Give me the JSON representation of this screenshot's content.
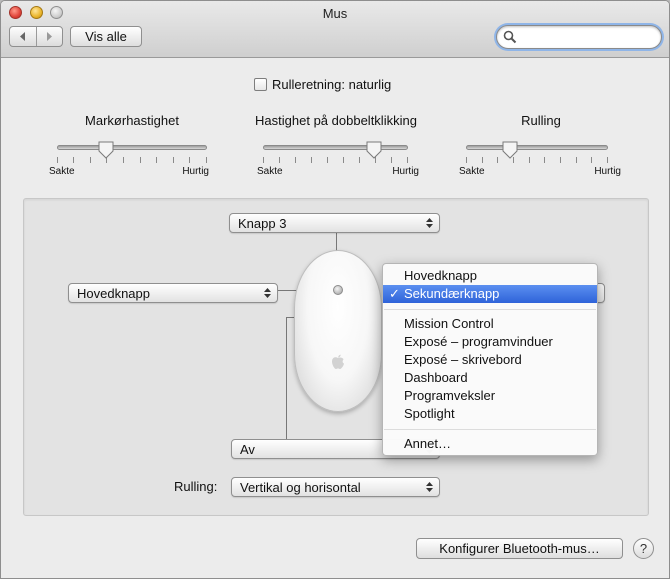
{
  "window": {
    "title": "Mus"
  },
  "toolbar": {
    "show_all_label": "Vis alle",
    "back_icon": "chevron-left-icon",
    "forward_icon": "chevron-right-icon"
  },
  "search": {
    "value": "",
    "placeholder": ""
  },
  "scroll_direction": {
    "label": "Rulleretning: naturlig",
    "checked": false
  },
  "sliders": [
    {
      "title": "Markørhastighet",
      "min_label": "Sakte",
      "max_label": "Hurtig",
      "position": 0.4
    },
    {
      "title": "Hastighet på dobbeltklikking",
      "min_label": "Sakte",
      "max_label": "Hurtig",
      "position": 0.75
    },
    {
      "title": "Rulling",
      "min_label": "Sakte",
      "max_label": "Hurtig",
      "position": 0.3
    }
  ],
  "buttons_panel": {
    "top_button": "Knapp 3",
    "left_button": "Hovedknapp",
    "bottom_button": "Av",
    "scrolling_label": "Rulling:",
    "scrolling_value": "Vertikal og horisontal"
  },
  "menu": {
    "items": [
      "Hovedknapp",
      "Sekundærknapp",
      "Mission Control",
      "Exposé – programvinduer",
      "Exposé – skrivebord",
      "Dashboard",
      "Programveksler",
      "Spotlight",
      "Annet…"
    ],
    "selected_index": 1,
    "checkmark": "✓"
  },
  "footer": {
    "configure_bluetooth_label": "Konfigurer Bluetooth-mus…",
    "help_label": "?"
  },
  "colors": {
    "selection": "#2e63d9",
    "focus_ring": "#8fb5e8"
  }
}
